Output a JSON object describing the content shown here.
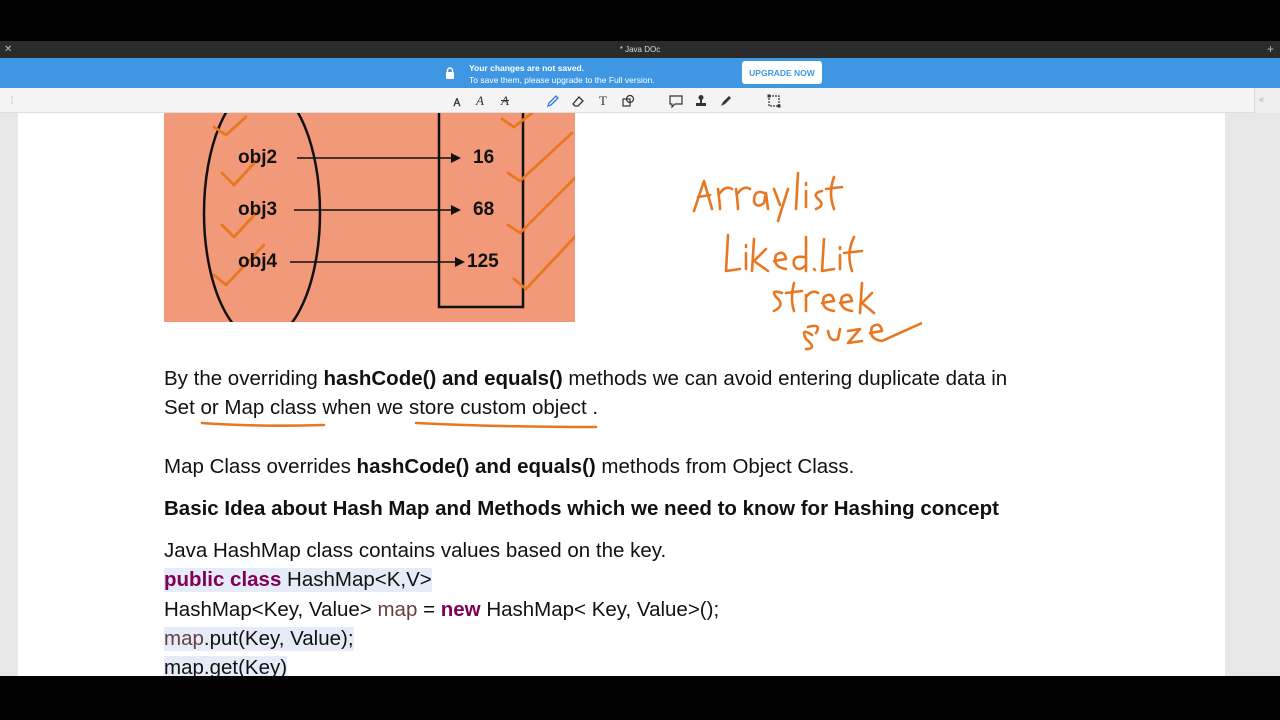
{
  "window": {
    "title": "* Java DOc"
  },
  "banner": {
    "line1": "Your changes are not saved.",
    "line2": "To save them, please upgrade to the Full version.",
    "upgrade_label": "UPGRADE NOW"
  },
  "toolbar": {
    "tools": [
      "text-edit-icon",
      "font-icon",
      "strikethrough-font-icon",
      "pen-icon",
      "eraser-icon",
      "text-box-icon",
      "shape-icon",
      "comment-icon",
      "stamp-icon",
      "signature-icon",
      "crop-icon"
    ]
  },
  "palette": {
    "colors": [
      "#ff0000",
      "#000000",
      "#1b8a2f",
      "#e87722",
      "#8a2be2"
    ],
    "selected": "#e87722"
  },
  "diagram": {
    "objects": [
      "obj2",
      "obj3",
      "obj4"
    ],
    "values": [
      "16",
      "68",
      "125"
    ]
  },
  "annotations": {
    "handwriting_color": "#e87722"
  },
  "content": {
    "p1_a": "By the overriding ",
    "p1_b": "hashCode() and equals()",
    "p1_c": " methods we can avoid entering duplicate data in",
    "p2": "Set or Map  class when we store custom object .",
    "p3_a": "Map Class overrides ",
    "p3_b": "hashCode() and equals()",
    "p3_c": " methods from Object Class.",
    "heading": "Basic Idea about Hash Map and Methods which we need to know for Hashing concept",
    "p4": "Java HashMap class contains values based on the key.",
    "code1_kw": "public class",
    "code1_rest": " HashMap<K,V>",
    "code2_a": "HashMap<Key, Value> ",
    "code2_var": "map",
    "code2_b": " = ",
    "code2_kw": "new",
    "code2_c": " HashMap< Key, Value>();",
    "code3_var": "map",
    "code3_rest": ".put(Key, Value);",
    "code4": "map.get(Key)"
  }
}
